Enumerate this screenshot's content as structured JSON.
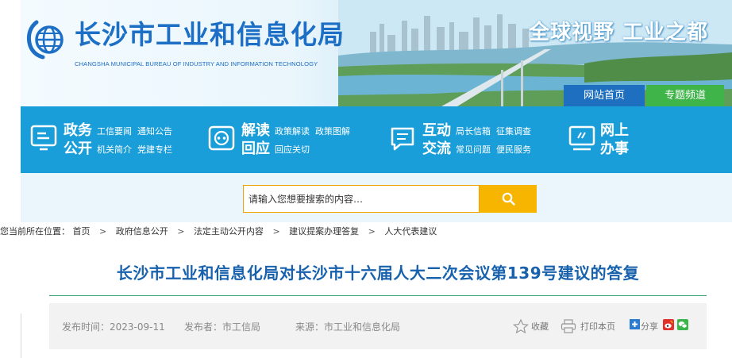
{
  "header": {
    "title": "长沙市工业和信息化局",
    "subtitle": "CHANGSHA MUNICIPAL BUREAU OF INDUSTRY AND INFORMATION TECHNOLOGY",
    "slogan": "全球视野 工业之都",
    "nav": {
      "home": "网站首页",
      "special": "专题频道"
    }
  },
  "services": [
    {
      "icon": "monitor-icon",
      "line1": "政务",
      "line2": "公开",
      "links1": [
        "工信要闻",
        "通知公告"
      ],
      "links2": [
        "机关简介",
        "党建专栏"
      ]
    },
    {
      "icon": "eye-icon",
      "line1": "解读",
      "line2": "回应",
      "links1": [
        "政策解读",
        "政策图解"
      ],
      "links2": [
        "回应关切"
      ]
    },
    {
      "icon": "chat-bubble-icon",
      "line1": "互动",
      "line2": "交流",
      "links1": [
        "局长信箱",
        "征集调查"
      ],
      "links2": [
        "常见问题",
        "便民服务"
      ]
    },
    {
      "icon": "online-office-icon",
      "line1": "网上",
      "line2": "办事",
      "links1": [],
      "links2": []
    }
  ],
  "search": {
    "placeholder": "请输入您想要搜索的内容…",
    "button_icon": "search-icon"
  },
  "breadcrumb": {
    "prefix": "您当前所在位置：",
    "items": [
      "首页",
      "政府信息公开",
      "法定主动公开内容",
      "建议提案办理答复",
      "人大代表建议"
    ],
    "separator": ">"
  },
  "article": {
    "title": "长沙市工业和信息化局对长沙市十六届人大二次会议第139号建议的答复",
    "published": "发布时间：2023-09-11",
    "publisher": "发布者：市工信局",
    "source": "来源：市工业和信息化局",
    "tools": {
      "favorite": "收藏",
      "print": "打印本页",
      "share": "分享"
    }
  },
  "colors": {
    "brand_blue": "#1d6fc6",
    "service_bar": "#1a9ed9",
    "search_button": "#f7b500",
    "title_blue": "#1761ad",
    "green_tab": "#3fb449"
  }
}
